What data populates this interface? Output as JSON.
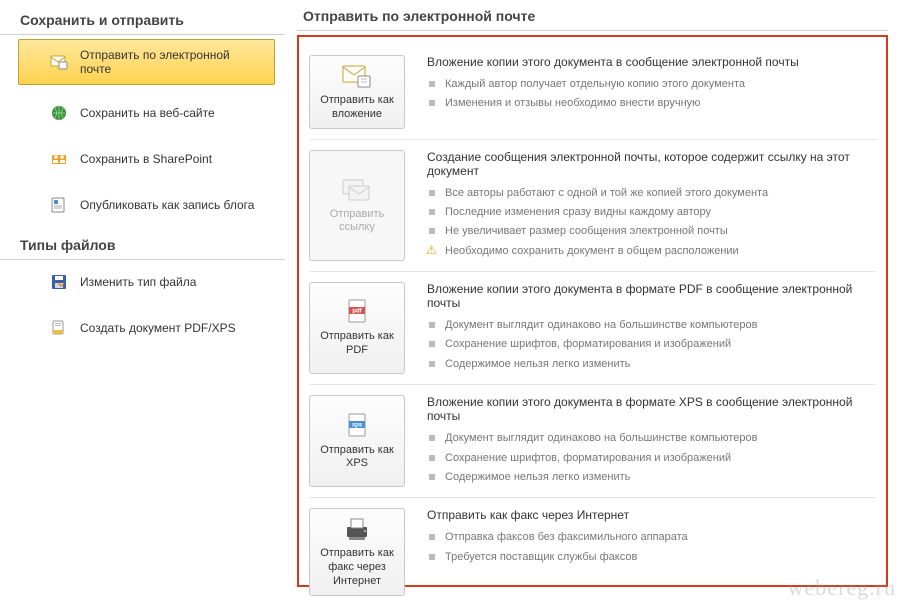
{
  "sidebar": {
    "section1_title": "Сохранить и отправить",
    "items1": [
      {
        "label": "Отправить по электронной почте"
      },
      {
        "label": "Сохранить на веб-сайте"
      },
      {
        "label": "Сохранить в SharePoint"
      },
      {
        "label": "Опубликовать как запись блога"
      }
    ],
    "section2_title": "Типы файлов",
    "items2": [
      {
        "label": "Изменить тип файла"
      },
      {
        "label": "Создать документ PDF/XPS"
      }
    ]
  },
  "main": {
    "title": "Отправить по электронной почте",
    "options": [
      {
        "button": "Отправить как вложение",
        "heading": "Вложение копии этого документа в сообщение электронной почты",
        "bullets": [
          "Каждый автор получает отдельную копию этого документа",
          "Изменения и отзывы необходимо внести вручную"
        ]
      },
      {
        "button": "Отправить ссылку",
        "disabled": true,
        "heading": "Создание сообщения электронной почты, которое содержит ссылку на этот документ",
        "bullets": [
          "Все авторы работают с одной и той же копией этого документа",
          "Последние изменения сразу видны каждому автору",
          "Не увеличивает размер сообщения электронной почты"
        ],
        "warn": "Необходимо сохранить документ в общем расположении"
      },
      {
        "button": "Отправить как PDF",
        "heading": "Вложение копии этого документа в формате PDF в сообщение электронной почты",
        "bullets": [
          "Документ выглядит одинаково на большинстве компьютеров",
          "Сохранение шрифтов, форматирования и изображений",
          "Содержимое нельзя легко изменить"
        ]
      },
      {
        "button": "Отправить как XPS",
        "heading": "Вложение копии этого документа в формате XPS в сообщение электронной почты",
        "bullets": [
          "Документ выглядит одинаково на большинстве компьютеров",
          "Сохранение шрифтов, форматирования и изображений",
          "Содержимое нельзя легко изменить"
        ]
      },
      {
        "button": "Отправить как факс через Интернет",
        "heading": "Отправить как факс через Интернет",
        "bullets": [
          "Отправка факсов без факсимильного аппарата",
          "Требуется поставщик службы факсов"
        ]
      }
    ]
  },
  "watermark": "webereg.ru"
}
